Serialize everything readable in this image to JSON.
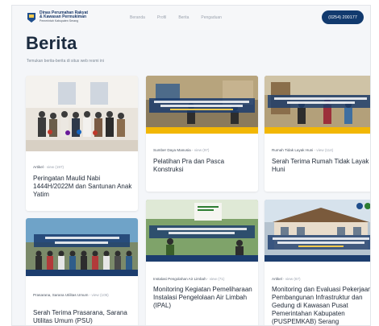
{
  "brand": {
    "line1": "Dinas Perumahan Rakyat",
    "line2": "& Kawasan Permukiman",
    "line3": "Pemerintah Kabupaten Serang"
  },
  "nav": [
    "Beranda",
    "Profil",
    "Berita",
    "Pengaduan"
  ],
  "phone": "(0254) 200177",
  "page": {
    "title": "Berita",
    "subtitle": "Temukan berita-berita di situs web resmi ini"
  },
  "articles": [
    {
      "category": "Artikel",
      "views": "view (197)",
      "title": "Peringatan Maulid Nabi 1444H/2022M dan Santunan Anak Yatim"
    },
    {
      "category": "Sumber Daya Manusia",
      "views": "view (97)",
      "title": "Pelatihan Pra dan Pasca Konstruksi"
    },
    {
      "category": "Rumah Tidak Layak Huni",
      "views": "view (114)",
      "title": "Serah Terima Rumah Tidak Layak Huni"
    },
    {
      "category": "Prasarana, Sarana Utilitas Umum",
      "views": "view (105)",
      "title": "Serah Terima Prasarana, Sarana Utilitas Umum (PSU)"
    },
    {
      "category": "Instalasi Pengolahan Air Limbah",
      "views": "view (71)",
      "title": "Monitoring Kegiatan Pemeliharaan Instalasi Pengelolaan Air Limbah (IPAL)"
    },
    {
      "category": "Artikel",
      "views": "view (67)",
      "title": "Monitoring dan Evaluasi Pekerjaan Pembangunan Infrastruktur dan Gedung di Kawasan Pusat Pemerintahan Kabupaten (PUSPEMKAB) Serang"
    }
  ]
}
